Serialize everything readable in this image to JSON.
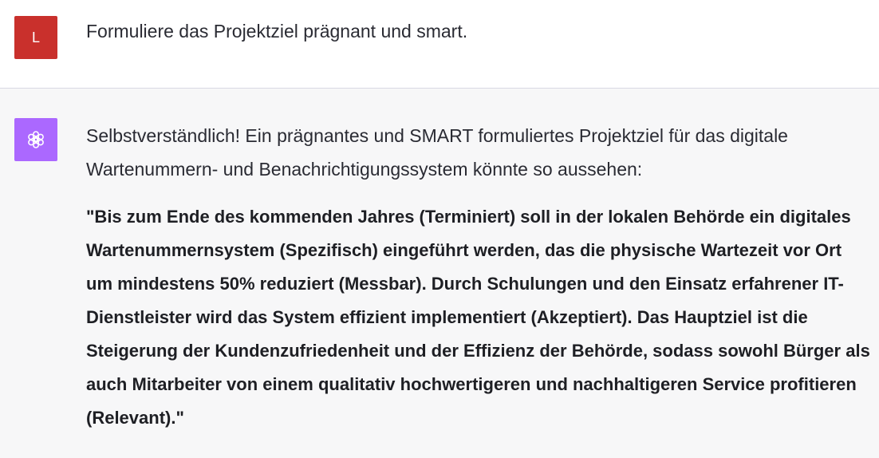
{
  "user_message": {
    "avatar_letter": "L",
    "avatar_color": "#c9302c",
    "text": "Formuliere das Projektziel prägnant und smart."
  },
  "assistant_message": {
    "avatar_icon": "openai-logo-icon",
    "avatar_color": "#ab68ff",
    "intro": "Selbstverständlich! Ein prägnantes und SMART formuliertes Projektziel für das digitale Wartenummern- und Benachrichtigungssystem könnte so aussehen:",
    "quote": "\"Bis zum Ende des kommenden Jahres (Terminiert) soll in der lokalen Behörde ein digitales Wartenummernsystem (Spezifisch) eingeführt werden, das die physische Wartezeit vor Ort um mindestens 50% reduziert (Messbar). Durch Schulungen und den Einsatz erfahrener IT-Dienstleister wird das System effizient implementiert (Akzeptiert). Das Hauptziel ist die Steigerung der Kundenzufriedenheit und der Effizienz der Behörde, sodass sowohl Bürger als auch Mitarbeiter von einem qualitativ hochwertigeren und nachhaltigeren Service profitieren (Relevant).\""
  }
}
